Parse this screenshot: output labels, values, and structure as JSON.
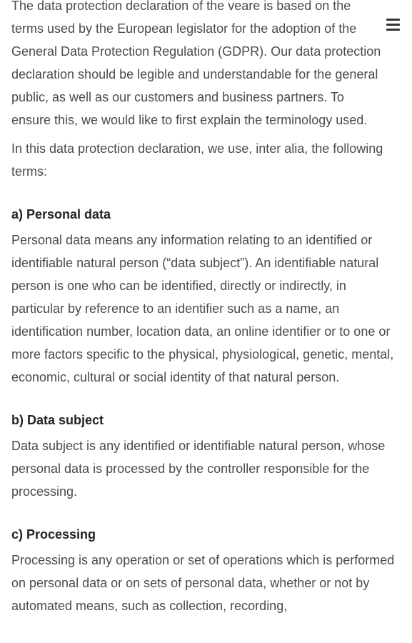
{
  "intro": {
    "paragraph1": "The data protection declaration of the veare is based on the terms used by the European legislator for the adoption of the General Data Protection Regulation (GDPR). Our data protection declaration should be legible and understandable for the general public, as well as our customers and business partners. To ensure this, we would like to first explain the terminology used.",
    "paragraph2": "In this data protection declaration, we use, inter alia, the following terms:"
  },
  "sections": [
    {
      "heading": "a) Personal data",
      "body": "Personal data means any information relating to an identified or identifiable natural person (“data subject”). An identifiable natural person is one who can be identified, directly or indirectly, in particular by reference to an identifier such as a name, an identification number, location data, an online identifier or to one or more factors specific to the physical, physiological, genetic, mental, economic, cultural or social identity of that natural person."
    },
    {
      "heading": "b) Data subject",
      "body": "Data subject is any identified or identifiable natural person, whose personal data is processed by the controller responsible for the processing."
    },
    {
      "heading": "c) Processing",
      "body": "Processing is any operation or set of operations which is performed on personal data or on sets of personal data, whether or not by automated means, such as collection, recording,"
    }
  ],
  "menu": {
    "icon": "hamburger-menu-icon"
  }
}
